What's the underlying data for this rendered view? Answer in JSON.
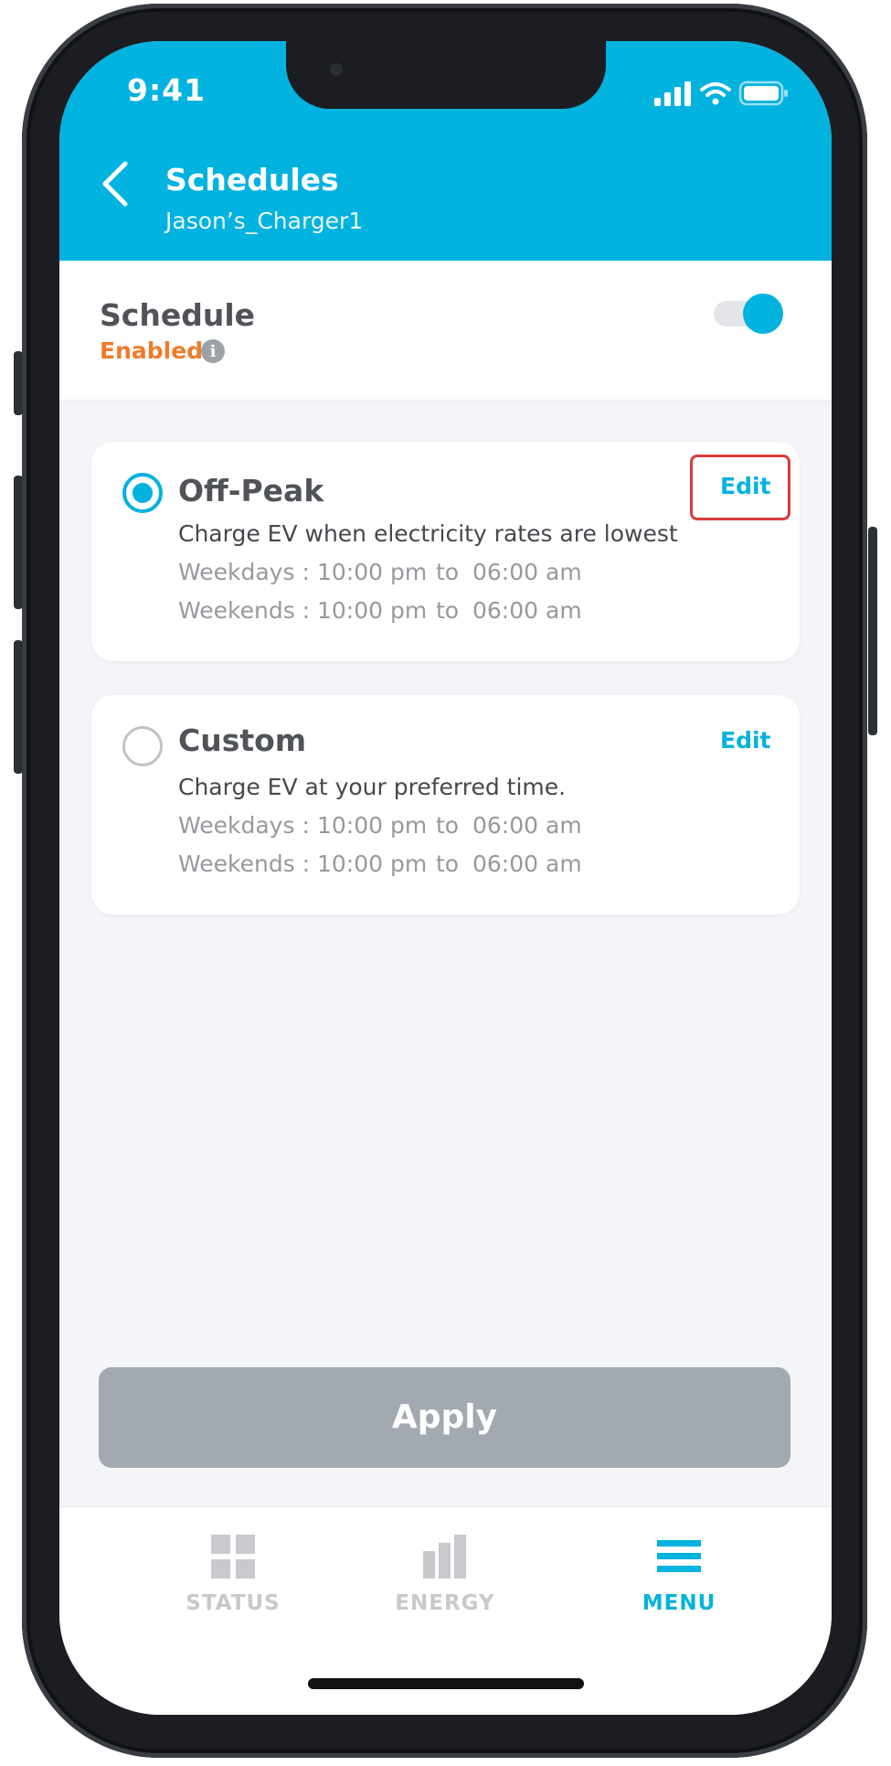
{
  "status_bar": {
    "time": "9:41"
  },
  "header": {
    "title": "Schedules",
    "subtitle": "Jason’s_Charger1"
  },
  "schedule": {
    "label": "Schedule",
    "status": "Enabled",
    "enabled": true
  },
  "options": [
    {
      "name": "Off-Peak",
      "selected": true,
      "description": "Charge EV when electricity rates are lowest",
      "edit_label": "Edit",
      "rows": [
        {
          "label": "Weekdays :",
          "start": "10:00 pm",
          "to": "to",
          "end": "06:00 am"
        },
        {
          "label": "Weekends :",
          "start": "10:00 pm",
          "to": "to",
          "end": "06:00 am"
        }
      ]
    },
    {
      "name": "Custom",
      "selected": false,
      "description": "Charge EV at your preferred time.",
      "edit_label": "Edit",
      "rows": [
        {
          "label": "Weekdays :",
          "start": "10:00 pm",
          "to": "to",
          "end": "06:00 am"
        },
        {
          "label": "Weekends :",
          "start": "10:00 pm",
          "to": "to",
          "end": "06:00 am"
        }
      ]
    }
  ],
  "apply_label": "Apply",
  "tabs": [
    {
      "label": "STATUS",
      "icon": "grid-icon",
      "active": false
    },
    {
      "label": "ENERGY",
      "icon": "bar-chart-icon",
      "active": false
    },
    {
      "label": "MENU",
      "icon": "menu-icon",
      "active": true
    }
  ],
  "colors": {
    "accent": "#02b2df",
    "enabled": "#ef7b2b",
    "apply_disabled": "#a2a9b1",
    "highlight_box": "#d93c3c"
  }
}
